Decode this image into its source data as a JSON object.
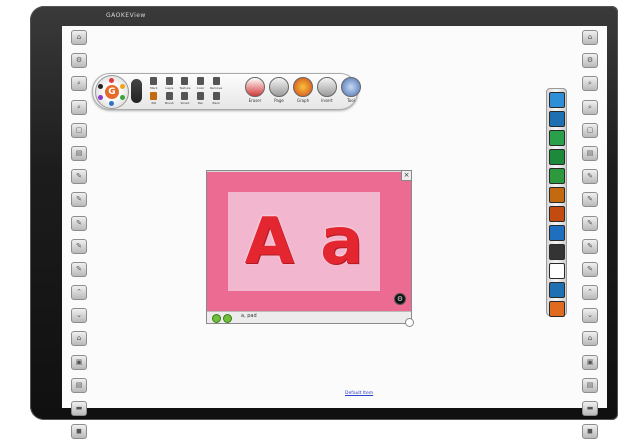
{
  "app": {
    "brand": "GAOKEView"
  },
  "left_sidebar": {
    "buttons": [
      "⌂",
      "⚙",
      "⌕",
      "⌕",
      "▢",
      "▤",
      "✎",
      "✎",
      "✎",
      "✎",
      "✎",
      "⌃",
      "⌄",
      "⌂",
      "▣",
      "▤",
      "▬",
      "◼"
    ]
  },
  "right_sidebar": {
    "buttons": [
      "⌂",
      "⚙",
      "⌕",
      "⌕",
      "▢",
      "▤",
      "✎",
      "✎",
      "✎",
      "✎",
      "✎",
      "⌃",
      "⌄",
      "⌂",
      "▣",
      "▤",
      "▬",
      "◼"
    ]
  },
  "top_toolbar": {
    "dial_label": "G",
    "mini_tools": [
      {
        "label": "Mark"
      },
      {
        "label": "Lapis"
      },
      {
        "label": "Texture"
      },
      {
        "label": "Color"
      },
      {
        "label": "Remove"
      },
      {
        "label": "Pat"
      },
      {
        "label": "Brush"
      },
      {
        "label": "Smart"
      },
      {
        "label": "Pen"
      },
      {
        "label": "Back"
      }
    ],
    "big_tools": [
      {
        "label": "Eraser"
      },
      {
        "label": "Page"
      },
      {
        "label": "Graph"
      },
      {
        "label": "Insert"
      },
      {
        "label": "Tool"
      }
    ]
  },
  "tool_strip": {
    "colors": [
      "#2e8fd6",
      "#1f6fb3",
      "#2aa04a",
      "#1c8a3a",
      "#2c9a3c",
      "#c36a10",
      "#c34a10",
      "#1e6fc0",
      "#343434",
      "#ffffff",
      "#1f6fb3",
      "#e06a1f"
    ]
  },
  "flashcard": {
    "letters": [
      "A",
      "a"
    ],
    "close_glyph": "×",
    "gear_glyph": "⚙",
    "caption": "a, pad"
  },
  "footer": {
    "link": "Default Item"
  }
}
